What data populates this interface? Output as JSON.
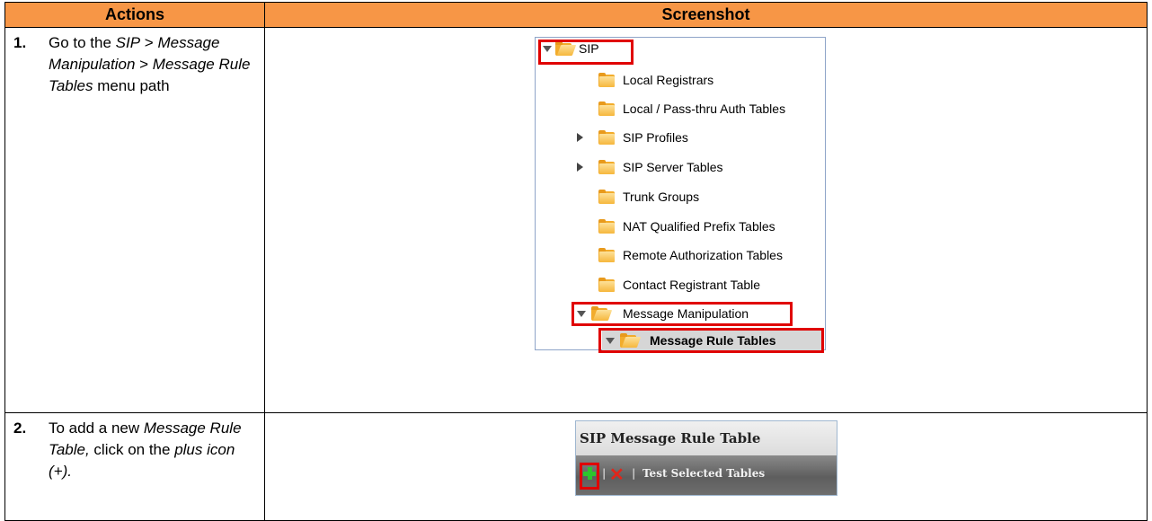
{
  "header": {
    "actions": "Actions",
    "screenshot": "Screenshot"
  },
  "step1": {
    "num": "1.",
    "t1": "Go to the ",
    "i1": "SIP",
    "t2": " > ",
    "i2": "Message Manipulation",
    "t3": " > ",
    "i3": "Message Rule Tables",
    "t4": " menu path"
  },
  "tree": {
    "root": "SIP",
    "items": [
      "Local Registrars",
      "Local / Pass-thru Auth Tables",
      "SIP Profiles",
      "SIP Server Tables",
      "Trunk Groups",
      "NAT Qualified Prefix Tables",
      "Remote Authorization Tables",
      "Contact Registrant Table",
      "Message Manipulation",
      "Message Rule Tables"
    ]
  },
  "step2": {
    "num": "2.",
    "t1": "To add a new ",
    "i1": "Message Rule Table,",
    "t2": " click on the ",
    "i2": "plus icon (+)."
  },
  "panel": {
    "title": "SIP Message Rule Table",
    "sep": "|",
    "test_label": "Test Selected Tables"
  },
  "colors": {
    "header_bg": "#f79646",
    "highlight": "#e00000"
  }
}
